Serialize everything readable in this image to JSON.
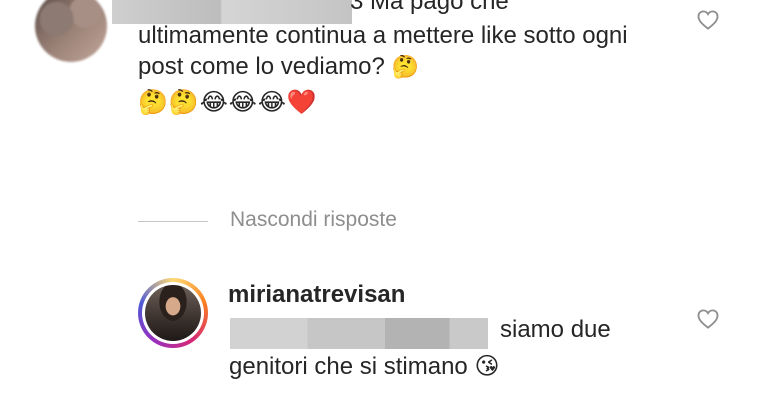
{
  "comment": {
    "cut_text": "3 Ma pago che",
    "text": "ultimamente continua a mettere like sotto ogni post come lo vediamo?",
    "inline_emoji": "🤔",
    "emoji_row": "🤔🤔😂😂😂❤️"
  },
  "replies_toggle": {
    "label": "Nascondi risposte"
  },
  "reply": {
    "username": "mirianatrevisan",
    "line1": "siamo due",
    "line2": "genitori che si stimano",
    "emoji": "😘"
  },
  "colors": {
    "text": "#262626",
    "secondary": "#8e8e8e",
    "heart_outline": "#8e8e8e"
  },
  "icons": {
    "like": "heart-outline-icon"
  }
}
